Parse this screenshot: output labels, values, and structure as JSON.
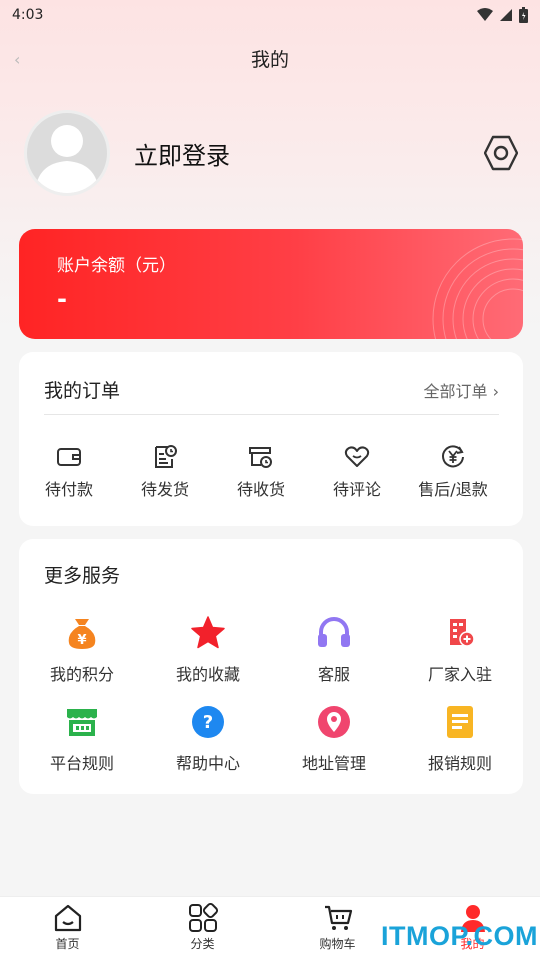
{
  "status_bar": {
    "time": "4:03"
  },
  "header": {
    "title": "我的"
  },
  "profile": {
    "login_label": "立即登录"
  },
  "balance": {
    "label": "账户余额（元）",
    "value": "-"
  },
  "orders": {
    "title": "我的订单",
    "all_link": "全部订单 ›",
    "items": [
      {
        "label": "待付款",
        "icon": "wallet-icon"
      },
      {
        "label": "待发货",
        "icon": "document-clock-icon"
      },
      {
        "label": "待收货",
        "icon": "box-clock-icon"
      },
      {
        "label": "待评论",
        "icon": "heart-chat-icon"
      },
      {
        "label": "售后/退款",
        "icon": "yen-refund-icon"
      }
    ]
  },
  "services": {
    "title": "更多服务",
    "items": [
      {
        "label": "我的积分",
        "icon": "money-bag-icon",
        "color": "#f5841f"
      },
      {
        "label": "我的收藏",
        "icon": "star-icon",
        "color": "#f2212b"
      },
      {
        "label": "客服",
        "icon": "headset-icon",
        "color": "#9177f2"
      },
      {
        "label": "厂家入驻",
        "icon": "building-add-icon",
        "color": "#f0474a"
      },
      {
        "label": "平台规则",
        "icon": "store-icon",
        "color": "#2bb24c"
      },
      {
        "label": "帮助中心",
        "icon": "question-icon",
        "color": "#1e88f0"
      },
      {
        "label": "地址管理",
        "icon": "location-pin-icon",
        "color": "#f0456e"
      },
      {
        "label": "报销规则",
        "icon": "receipt-icon",
        "color": "#f8b523"
      }
    ]
  },
  "tabbar": {
    "items": [
      {
        "label": "首页",
        "icon": "home-icon"
      },
      {
        "label": "分类",
        "icon": "category-icon"
      },
      {
        "label": "购物车",
        "icon": "cart-icon"
      },
      {
        "label": "我的",
        "icon": "user-icon",
        "active": true
      }
    ]
  },
  "watermark": "ITMOP.COM",
  "colors": {
    "accent": "#ff2a2a",
    "balance_card": "#ff3038"
  }
}
